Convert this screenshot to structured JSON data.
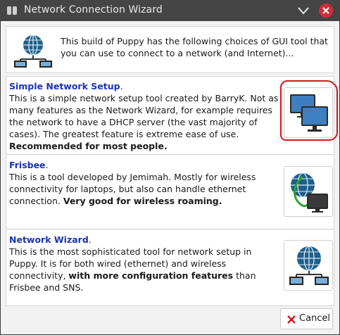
{
  "window": {
    "title": "Network Connection Wizard",
    "colors": {
      "titlebar": "#454545",
      "close": "#d22d3a",
      "title_link": "#1a33b3",
      "highlight": "#d9141c"
    }
  },
  "intro": {
    "icon": "network-globe-icon",
    "text": "This build of Puppy has the following choices of GUI tool that you can use to connect to a network (and Internet)..."
  },
  "options": [
    {
      "title": "Simple Network Setup",
      "body": "This is a simple network setup tool created by BarryK. Not as many features as the Network Wizard, for example requires the network to have a DHCP server (the vast majority of cases). The greatest feature is extreme ease of use. ",
      "bold": "Recommended for most people.",
      "icon": "two-monitors-icon"
    },
    {
      "title": "Frisbee",
      "body": "This is a tool developed by Jemimah. Mostly for wireless connectivity for laptops, but also can handle ethernet connection. ",
      "bold": "Very good for wireless roaming.",
      "icon": "wireless-globe-monitor-icon"
    },
    {
      "title": "Network Wizard",
      "body_pre": "This is the most sophisticated tool for network setup in Puppy. It is for both wired (ethernet) and wireless connectivity, ",
      "bold": "with more configuration features",
      "body_post": " than Frisbee and SNS.",
      "icon": "network-globe-icon"
    }
  ],
  "footer": {
    "cancel_label": "Cancel"
  }
}
